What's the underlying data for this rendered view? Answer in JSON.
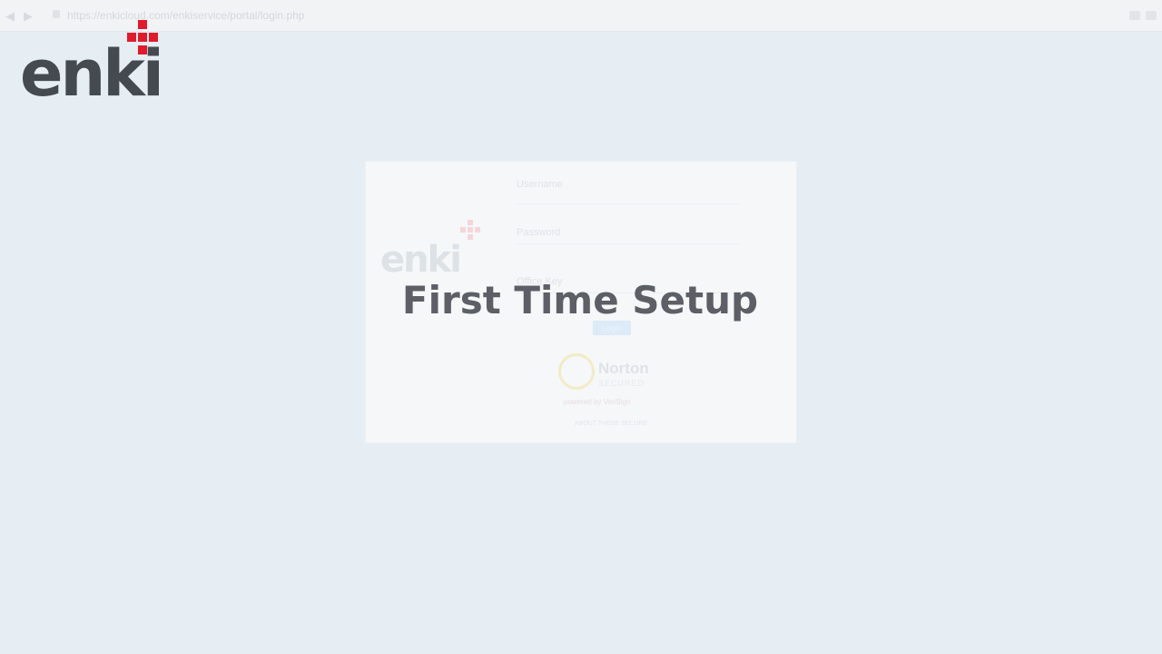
{
  "browser": {
    "url": "https://enkicloud.com/enkiservice/portal/login.php",
    "back_icon": "back-arrow-icon",
    "forward_icon": "forward-arrow-icon"
  },
  "logo": {
    "text": "enki",
    "brand_color": "#e01c2c",
    "text_color": "#454a50"
  },
  "login": {
    "username_label": "Username",
    "password_label": "Password",
    "office_key_label": "Office Key",
    "login_button": "Login",
    "logo_text": "enki",
    "norton_title": "Norton",
    "norton_subtitle": "SECURED",
    "verisign_text": "powered by VeriSign",
    "about_link": "ABOUT THESE SECURE"
  },
  "overlay": {
    "title": "First Time Setup"
  }
}
